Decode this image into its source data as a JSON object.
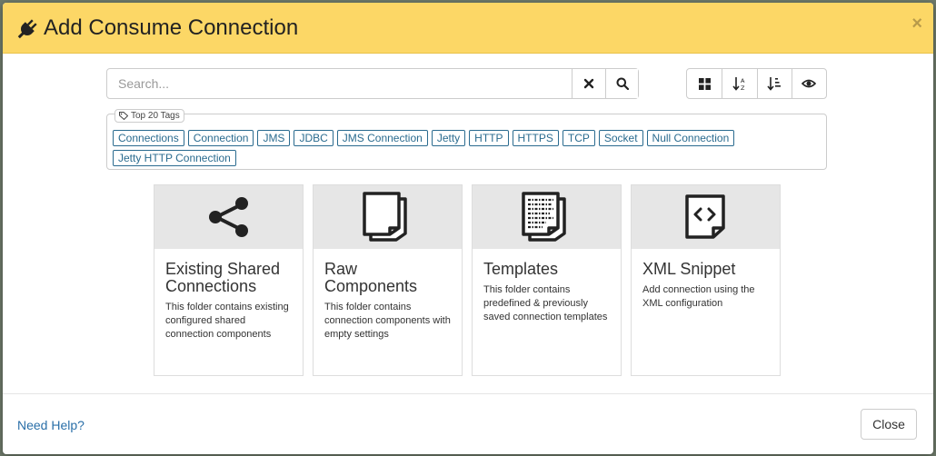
{
  "modal": {
    "title": "Add Consume Connection",
    "close_symbol": "×"
  },
  "search": {
    "placeholder": "Search...",
    "value": ""
  },
  "tags": {
    "legend": "Top 20 Tags",
    "items": [
      "Connections",
      "Connection",
      "JMS",
      "JDBC",
      "JMS Connection",
      "Jetty",
      "HTTP",
      "HTTPS",
      "TCP",
      "Socket",
      "Null Connection",
      "Jetty HTTP Connection"
    ]
  },
  "cards": [
    {
      "title": "Existing Shared Connections",
      "desc": "This folder contains existing configured shared connection components",
      "icon": "share-icon"
    },
    {
      "title": "Raw Components",
      "desc": "This folder contains connection components with empty settings",
      "icon": "blank-pages-icon"
    },
    {
      "title": "Templates",
      "desc": "This folder contains predefined & previously saved connection templates",
      "icon": "template-pages-icon"
    },
    {
      "title": "XML Snippet",
      "desc": "Add connection using the XML configuration",
      "icon": "code-page-icon"
    }
  ],
  "footer": {
    "help_label": "Need Help?",
    "close_label": "Close"
  },
  "colors": {
    "header_bg": "#fcd766",
    "tag_color": "#2a6b8f",
    "link_color": "#2a6fa8"
  }
}
